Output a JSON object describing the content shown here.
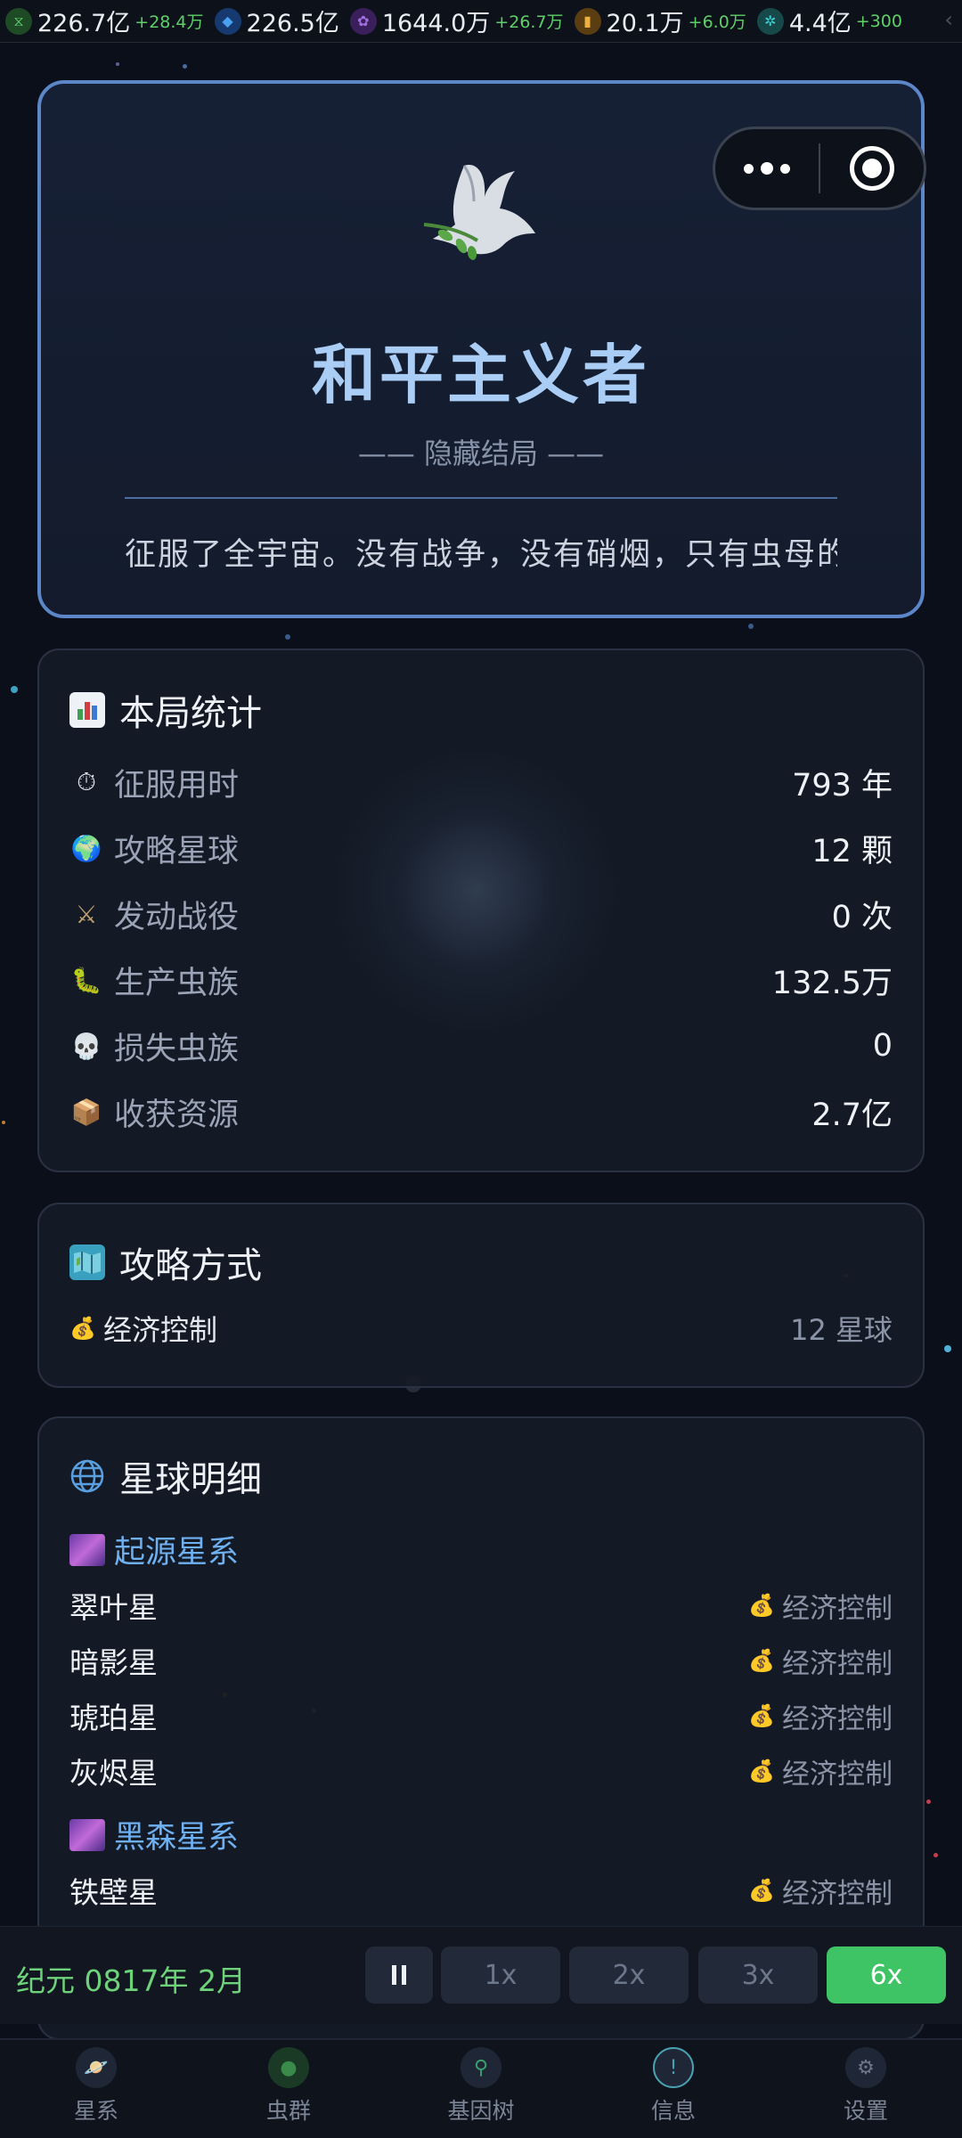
{
  "resources": [
    {
      "icon": "dna-icon",
      "color": "#3e8f4a",
      "value": "226.7亿",
      "delta": "+28.4万"
    },
    {
      "icon": "crystal-icon",
      "color": "#2e6fd0",
      "value": "226.5亿",
      "delta": ""
    },
    {
      "icon": "spore-icon",
      "color": "#6b3aa0",
      "value": "1644.0万",
      "delta": "+26.7万"
    },
    {
      "icon": "energy-icon",
      "color": "#a0701e",
      "value": "20.1万",
      "delta": "+6.0万"
    },
    {
      "icon": "gear-icon",
      "color": "#2a8a8a",
      "value": "4.4亿",
      "delta": "+300"
    }
  ],
  "hero": {
    "title": "和平主义者",
    "subtitle": "—— 隐藏结局 ——",
    "description": "征服了全宇宙。没有战争，没有硝烟，只有虫母的"
  },
  "stats": {
    "title": "本局统计",
    "rows": [
      {
        "icon": "stopwatch-icon",
        "glyph": "⏱",
        "label": "征服用时",
        "value": "793 年"
      },
      {
        "icon": "globe-icon",
        "glyph": "🌍",
        "label": "攻略星球",
        "value": "12 颗"
      },
      {
        "icon": "crossed-swords-icon",
        "glyph": "⚔",
        "label": "发动战役",
        "value": "0 次"
      },
      {
        "icon": "worm-icon",
        "glyph": "🐛",
        "label": "生产虫族",
        "value": "132.5万"
      },
      {
        "icon": "skull-icon",
        "glyph": "💀",
        "label": "损失虫族",
        "value": "0"
      },
      {
        "icon": "package-icon",
        "glyph": "📦",
        "label": "收获资源",
        "value": "2.7亿"
      }
    ]
  },
  "method": {
    "title": "攻略方式",
    "label": "经济控制",
    "value": "12 星球"
  },
  "planets": {
    "title": "星球明细",
    "galaxies": [
      {
        "name": "起源星系",
        "planets": [
          {
            "name": "翠叶星",
            "method": "经济控制"
          },
          {
            "name": "暗影星",
            "method": "经济控制"
          },
          {
            "name": "琥珀星",
            "method": "经济控制"
          },
          {
            "name": "灰烬星",
            "method": "经济控制"
          }
        ]
      },
      {
        "name": "黑森星系",
        "planets": [
          {
            "name": "铁壁星",
            "method": "经济控制"
          }
        ]
      }
    ]
  },
  "timebar": {
    "era": "纪元 0817年 2月",
    "speeds": [
      "1x",
      "2x",
      "3x",
      "6x"
    ],
    "active_speed": "6x"
  },
  "nav": [
    {
      "icon": "planet-icon",
      "label": "星系"
    },
    {
      "icon": "swarm-icon",
      "label": "虫群"
    },
    {
      "icon": "gene-tree-icon",
      "label": "基因树"
    },
    {
      "icon": "info-icon",
      "label": "信息"
    },
    {
      "icon": "gear-icon",
      "label": "设置"
    }
  ]
}
